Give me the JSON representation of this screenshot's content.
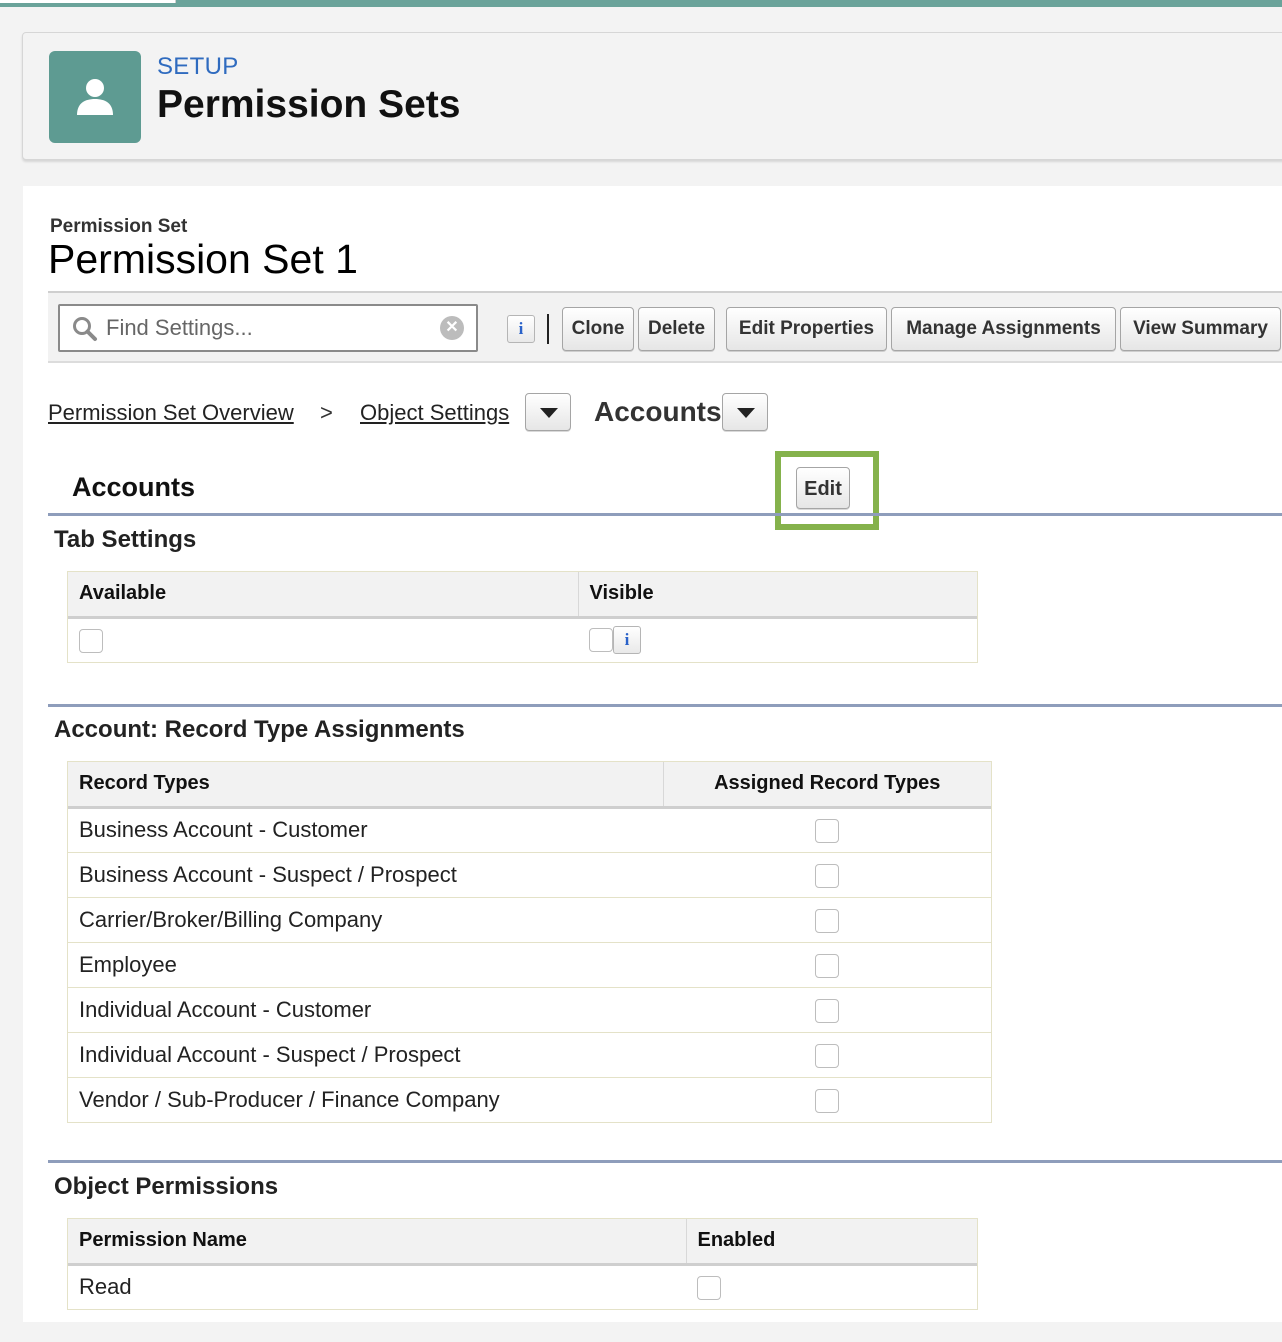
{
  "header": {
    "kicker": "SETUP",
    "title": "Permission Sets",
    "icon": "user-icon"
  },
  "permission_set": {
    "kicker": "Permission Set",
    "title": "Permission Set 1"
  },
  "toolbar": {
    "search_placeholder": "Find Settings...",
    "search_value": "",
    "info_label": "i",
    "buttons": {
      "clone": "Clone",
      "delete": "Delete",
      "edit_properties": "Edit Properties",
      "manage_assignments": "Manage Assignments",
      "view_summary": "View Summary"
    }
  },
  "breadcrumb": {
    "overview": "Permission Set Overview",
    "separator": ">",
    "object_settings": "Object Settings",
    "current": "Accounts"
  },
  "object_section": {
    "title": "Accounts",
    "edit_label": "Edit",
    "highlight_color": "#85b24c"
  },
  "tab_settings": {
    "title": "Tab Settings",
    "columns": [
      "Available",
      "Visible"
    ],
    "available_checked": false,
    "visible_checked": false,
    "info_label": "i"
  },
  "record_types": {
    "title": "Account: Record Type Assignments",
    "columns": [
      "Record Types",
      "Assigned Record Types"
    ],
    "rows": [
      {
        "name": "Business Account - Customer",
        "assigned": false
      },
      {
        "name": "Business Account - Suspect / Prospect",
        "assigned": false
      },
      {
        "name": "Carrier/Broker/Billing Company",
        "assigned": false
      },
      {
        "name": "Employee",
        "assigned": false
      },
      {
        "name": "Individual Account - Customer",
        "assigned": false
      },
      {
        "name": "Individual Account - Suspect / Prospect",
        "assigned": false
      },
      {
        "name": "Vendor / Sub-Producer / Finance Company",
        "assigned": false
      }
    ]
  },
  "object_permissions": {
    "title": "Object Permissions",
    "columns": [
      "Permission Name",
      "Enabled"
    ],
    "rows": [
      {
        "name": "Read",
        "enabled": false
      }
    ]
  },
  "colors": {
    "brand_icon": "#5e9b92",
    "link_blue": "#2f6bbf",
    "section_rule": "#8e9dbb"
  }
}
